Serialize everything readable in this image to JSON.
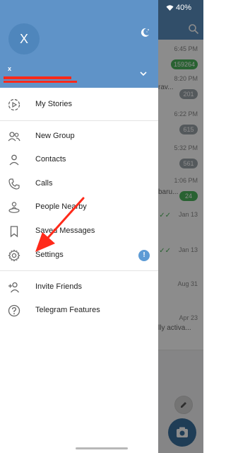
{
  "status_bar": {
    "battery": "40%"
  },
  "chat_list": {
    "rows": [
      {
        "time": "6:45 PM",
        "snippet": "",
        "badge": "159264",
        "badge_color": "#4bb35b",
        "read": false
      },
      {
        "time": "8:20 PM",
        "snippet": "rav...",
        "badge": "201",
        "badge_color": "#9aa2a8",
        "read": false
      },
      {
        "time": "6:22 PM",
        "snippet": "",
        "badge": "615",
        "badge_color": "#9aa2a8",
        "read": false
      },
      {
        "time": "5:32 PM",
        "snippet": "",
        "badge": "561",
        "badge_color": "#9aa2a8",
        "read": false
      },
      {
        "time": "1:06 PM",
        "snippet": "baru...",
        "badge": "24",
        "badge_color": "#4bb35b",
        "read": false
      },
      {
        "time": "Jan 13",
        "snippet": "",
        "badge": "",
        "badge_color": "",
        "read": true
      },
      {
        "time": "Jan 13",
        "snippet": "",
        "badge": "",
        "badge_color": "",
        "read": true
      },
      {
        "time": "Aug 31",
        "snippet": "",
        "badge": "",
        "badge_color": "",
        "read": false
      },
      {
        "time": "Apr 23",
        "snippet": "lly activa...",
        "badge": "",
        "badge_color": "",
        "read": false
      }
    ]
  },
  "drawer": {
    "avatar_initial": "X",
    "user_name": "x",
    "items": [
      {
        "label": "My Stories",
        "icon": "stories-icon"
      },
      {
        "label": "New Group",
        "icon": "group-icon"
      },
      {
        "label": "Contacts",
        "icon": "contact-icon"
      },
      {
        "label": "Calls",
        "icon": "phone-icon"
      },
      {
        "label": "People Nearby",
        "icon": "people-nearby-icon"
      },
      {
        "label": "Saved Messages",
        "icon": "bookmark-icon"
      },
      {
        "label": "Settings",
        "icon": "gear-icon",
        "badge": "!"
      },
      {
        "label": "Invite Friends",
        "icon": "add-user-icon"
      },
      {
        "label": "Telegram Features",
        "icon": "question-icon"
      }
    ]
  },
  "colors": {
    "header": "#5f93c8",
    "accent": "#5d9bd5",
    "annotation_arrow": "#ff2a1a"
  }
}
